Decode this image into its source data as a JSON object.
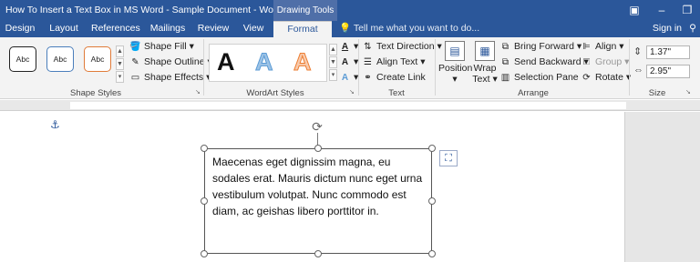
{
  "titlebar": {
    "title": "How To Insert a Text Box in MS Word - Sample Document - Word",
    "contextual_tab": "Drawing Tools"
  },
  "tabs": [
    "Design",
    "Layout",
    "References",
    "Mailings",
    "Review",
    "View",
    "Format"
  ],
  "active_tab": "Format",
  "tell_me": "Tell me what you want to do...",
  "sign_in": "Sign in",
  "ribbon": {
    "shape_styles": {
      "label": "Shape Styles",
      "gallery": [
        "Abc",
        "Abc",
        "Abc"
      ],
      "gallery_colors": [
        "#222222",
        "#4a7ebb",
        "#e07b39"
      ],
      "shape_fill": "Shape Fill",
      "shape_outline": "Shape Outline",
      "shape_effects": "Shape Effects"
    },
    "wordart_styles": {
      "label": "WordArt Styles",
      "letters": [
        "A",
        "A",
        "A"
      ]
    },
    "text": {
      "label": "Text",
      "text_direction": "Text Direction",
      "align_text": "Align Text",
      "create_link": "Create Link"
    },
    "arrange": {
      "label": "Arrange",
      "position": "Position",
      "wrap_text_1": "Wrap",
      "wrap_text_2": "Text",
      "bring_forward": "Bring Forward",
      "send_backward": "Send Backward",
      "selection_pane": "Selection Pane",
      "align": "Align",
      "group": "Group",
      "rotate": "Rotate"
    },
    "size": {
      "label": "Size",
      "height": "1.37\"",
      "width": "2.95\""
    }
  },
  "document": {
    "textbox_text": "Maecenas eget dignissim magna, eu sodales erat. Mauris dictum nunc eget urna vestibulum volutpat. Nunc commodo est diam, ac geishas libero porttitor in."
  }
}
